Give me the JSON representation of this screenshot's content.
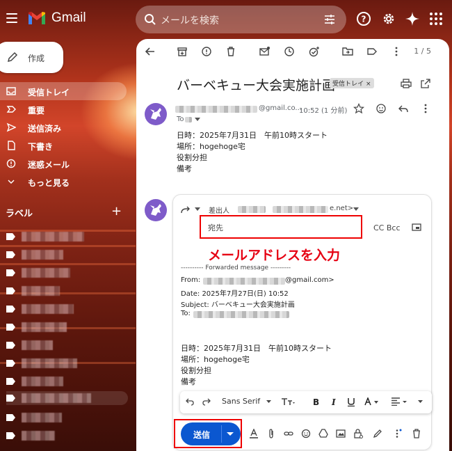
{
  "app": {
    "name": "Gmail"
  },
  "search": {
    "placeholder": "メールを検索"
  },
  "sidebar": {
    "compose_label": "作成",
    "items": [
      {
        "label": "受信トレイ"
      },
      {
        "label": "重要"
      },
      {
        "label": "送信済み"
      },
      {
        "label": "下書き"
      },
      {
        "label": "迷惑メール"
      },
      {
        "label": "もっと見る"
      }
    ],
    "labels_heading": "ラベル",
    "labels_add": "+"
  },
  "toolbar": {
    "pager": "1 / 5"
  },
  "email": {
    "subject": "バーベキュー大会実施計画",
    "inbox_chip": "受信トレイ",
    "inbox_chip_close": "×",
    "sender_suffix": "@gmail.co...",
    "time": "10:52 (1 分前)",
    "to_prefix": "To",
    "body": [
      "日時：2025年7月31日　午前10時スタート",
      "場所：hogehoge宅",
      "役割分担",
      "備考"
    ]
  },
  "reply": {
    "from_label": "差出人",
    "from_suffix": "e.net>",
    "to_label": "宛先",
    "cc_bcc": "CC Bcc",
    "annotation": "メールアドレスを入力",
    "forward_header": "---------- Forwarded message ---------",
    "fwd_from_prefix": "From:",
    "fwd_from_suffix": "@gmail.com>",
    "fwd_date": "Date: 2025年7月27日(日) 10:52",
    "fwd_subject": "Subject: バーベキュー大会実施計画",
    "fwd_to_prefix": "To:",
    "body": [
      "日時：2025年7月31日　午前10時スタート",
      "場所：hogehoge宅",
      "役割分担",
      "備考"
    ],
    "font": "Sans Serif",
    "send_label": "送信"
  },
  "colors": {
    "send": "#0b57d0",
    "annotation": "#e60012",
    "highlight": "#ee0000"
  }
}
